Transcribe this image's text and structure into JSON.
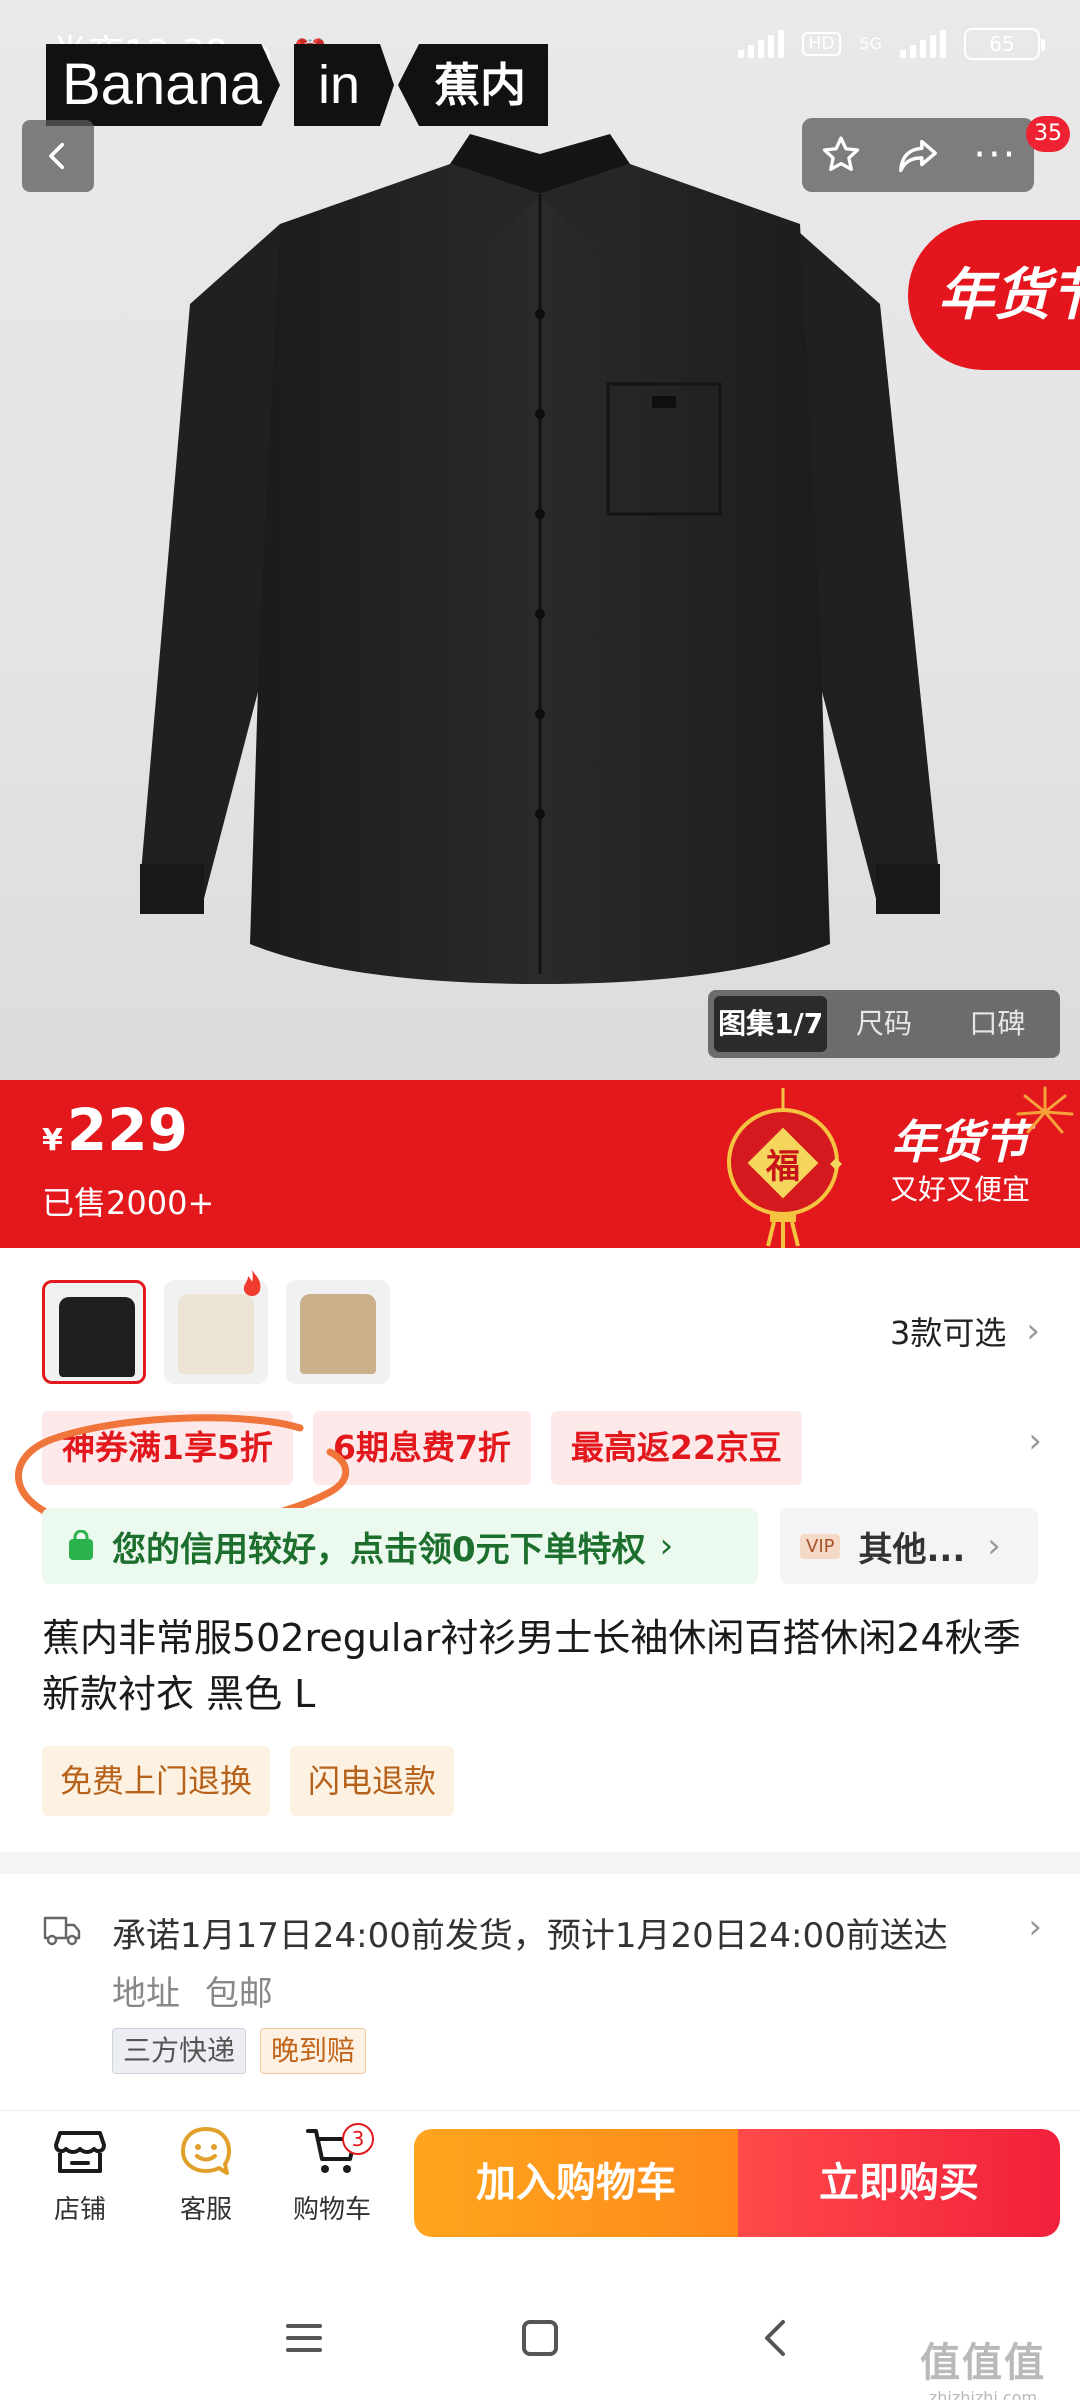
{
  "status_bar": {
    "time": "半夜12:38",
    "network": "5G",
    "hd": "HD",
    "battery": "65"
  },
  "brand": {
    "part1": "Banana",
    "part2": "in",
    "part3": "蕉内"
  },
  "top_actions": {
    "message_count": "35"
  },
  "festival_tag": "年货节",
  "gallery_tabs": [
    {
      "label": "图集1/7",
      "active": true
    },
    {
      "label": "尺码",
      "active": false
    },
    {
      "label": "口碑",
      "active": false
    }
  ],
  "price": {
    "currency": "¥",
    "amount": "229",
    "sold": "已售2000+",
    "band_festival": "年货节",
    "band_slogan": "又好又便宜",
    "lantern_char": "福"
  },
  "variants": {
    "count_label": "3款可选",
    "colors": [
      "#1f1f1f",
      "#ece4d4",
      "#c9b08b"
    ]
  },
  "coupons": [
    "神券满1享5折",
    "6期息费7折",
    "最高返22京豆"
  ],
  "credit": {
    "text": "您的信用较好，点击领0元下单特权",
    "vip": "VIP",
    "other": "其他..."
  },
  "product": {
    "title": "蕉内非常服502regular衬衫男士长袖休闲百搭休闲24秋季新款衬衣 黑色 L",
    "service_tags": [
      "免费上门退换",
      "闪电退款"
    ]
  },
  "shipping": {
    "promise": "承诺1月17日24:00前发货，预计1月20日24:00前送达",
    "address_label": "地址",
    "free_shipping": "包邮",
    "tags": [
      "三方快递",
      "晚到赔"
    ]
  },
  "bottom_bar": {
    "store": "店铺",
    "service": "客服",
    "cart": "购物车",
    "cart_count": "3",
    "add_to_cart": "加入购物车",
    "buy_now": "立即购买"
  },
  "watermark": {
    "line1": "值值值",
    "line2": "zhizhizhi.com"
  },
  "colors": {
    "accent_red": "#e3181d",
    "orange": "#ff9a1e",
    "green": "#1d6f2d"
  }
}
